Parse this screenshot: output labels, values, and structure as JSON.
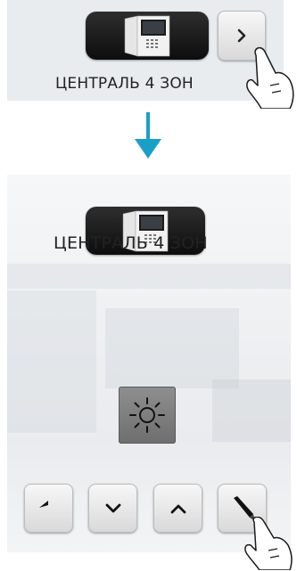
{
  "top_panel": {
    "device_name": "ЦЕНТРАЛЬ 4 ЗОН",
    "next_icon": "chevron-right-icon"
  },
  "transition": {
    "icon": "arrow-down-icon",
    "color": "#1a9fc9"
  },
  "bottom_panel": {
    "device_name": "ЦЕНТРАЛЬ 4 ЗОН",
    "mode_icon": "sun-icon",
    "controls": [
      {
        "name": "back-button",
        "icon": "undo-arrow-icon"
      },
      {
        "name": "down-button",
        "icon": "chevron-down-icon"
      },
      {
        "name": "up-button",
        "icon": "chevron-up-icon"
      },
      {
        "name": "edit-button",
        "icon": "pencil-icon"
      }
    ]
  },
  "colors": {
    "accent": "#1a9fc9",
    "panel": "#e9ecef"
  }
}
